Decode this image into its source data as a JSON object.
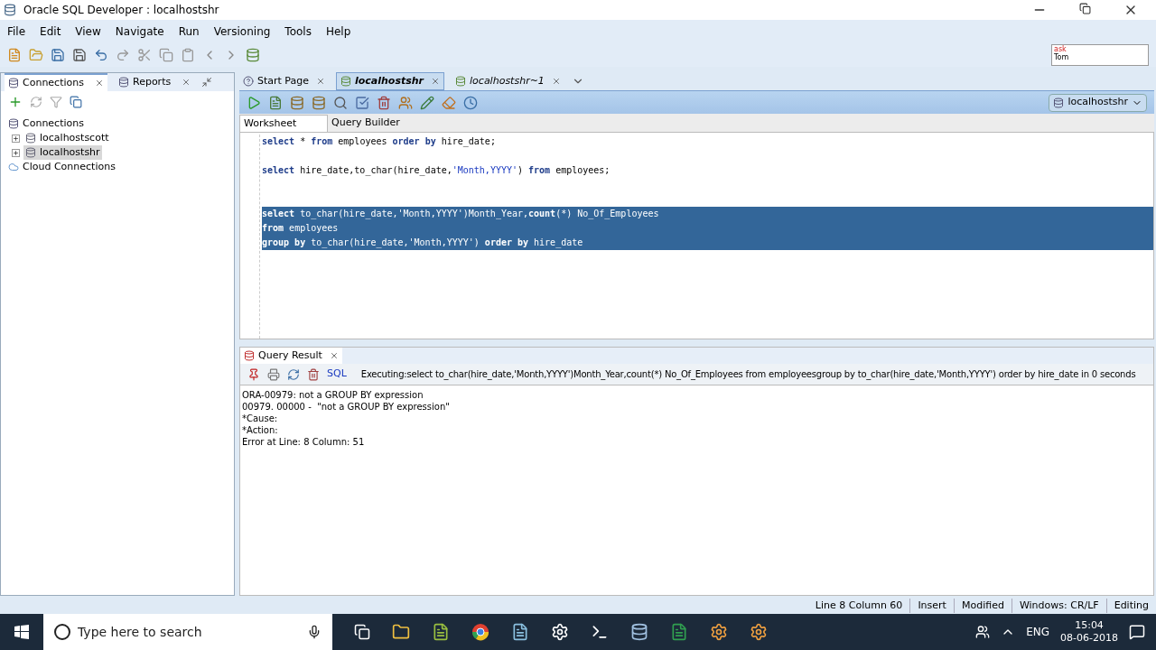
{
  "window": {
    "title": "Oracle SQL Developer : localhostshr"
  },
  "menu": [
    "File",
    "Edit",
    "View",
    "Navigate",
    "Run",
    "Versioning",
    "Tools",
    "Help"
  ],
  "asktom": {
    "line1": "ask",
    "line2": "Tom"
  },
  "left_tabs": [
    {
      "label": "Connections",
      "selected": true
    },
    {
      "label": "Reports",
      "selected": false
    }
  ],
  "tree": [
    {
      "label": "Connections",
      "kind": "root",
      "children": [
        {
          "label": "localhostscott",
          "kind": "db",
          "selected": false
        },
        {
          "label": "localhostshr",
          "kind": "db",
          "selected": true
        }
      ]
    },
    {
      "label": "Cloud Connections",
      "kind": "cloud"
    }
  ],
  "editor_tabs": [
    {
      "label": "Start Page",
      "selected": false,
      "italic": false
    },
    {
      "label": "localhostshr",
      "selected": true,
      "italic": true
    },
    {
      "label": "localhostshr~1",
      "selected": false,
      "italic": true
    }
  ],
  "connection_select": "localhostshr",
  "sub_tabs": [
    {
      "label": "Worksheet",
      "selected": true
    },
    {
      "label": "Query Builder",
      "selected": false
    }
  ],
  "code": [
    {
      "kind": "code",
      "selected": false,
      "tokens": [
        {
          "t": "select",
          "kind": "kw"
        },
        {
          "t": " * ",
          "kind": "plain"
        },
        {
          "t": "from",
          "kind": "kw"
        },
        {
          "t": " employees ",
          "kind": "plain"
        },
        {
          "t": "order by",
          "kind": "kw"
        },
        {
          "t": " hire_date;",
          "kind": "plain"
        }
      ]
    },
    {
      "kind": "blank",
      "selected": false
    },
    {
      "kind": "code",
      "selected": false,
      "tokens": [
        {
          "t": "select",
          "kind": "kw"
        },
        {
          "t": " hire_date,to_char(hire_date,",
          "kind": "plain"
        },
        {
          "t": "'Month,YYYY'",
          "kind": "str"
        },
        {
          "t": ") ",
          "kind": "plain"
        },
        {
          "t": "from",
          "kind": "kw"
        },
        {
          "t": " employees;",
          "kind": "plain"
        }
      ]
    },
    {
      "kind": "blank",
      "selected": false
    },
    {
      "kind": "blank",
      "selected": false
    },
    {
      "kind": "code",
      "selected": true,
      "tokens": [
        {
          "t": "select",
          "kind": "kw"
        },
        {
          "t": " to_char(hire_date,'Month,YYYY')Month_Year,",
          "kind": "plain"
        },
        {
          "t": "count",
          "kind": "kw"
        },
        {
          "t": "(*) No_Of_Employees",
          "kind": "plain"
        }
      ]
    },
    {
      "kind": "code",
      "selected": true,
      "tokens": [
        {
          "t": "from",
          "kind": "kw"
        },
        {
          "t": " employees",
          "kind": "plain"
        }
      ]
    },
    {
      "kind": "code",
      "selected": true,
      "tokens": [
        {
          "t": "group by",
          "kind": "kw"
        },
        {
          "t": " to_char(hire_date,'Month,YYYY') ",
          "kind": "plain"
        },
        {
          "t": "order by",
          "kind": "kw"
        },
        {
          "t": " hire_date",
          "kind": "plain"
        }
      ]
    }
  ],
  "result": {
    "tab": "Query Result",
    "sql_label": "SQL",
    "executing": "Executing:select to_char(hire_date,'Month,YYYY')Month_Year,count(*) No_Of_Employees from employeesgroup by to_char(hire_date,'Month,YYYY') order by hire_date in 0 seconds",
    "output": [
      "ORA-00979: not a GROUP BY expression",
      "00979. 00000 -  \"not a GROUP BY expression\"",
      "*Cause:",
      "*Action:",
      "Error at Line: 8 Column: 51"
    ]
  },
  "status_bar": [
    "Line 8 Column 60",
    "Insert",
    "Modified",
    "Windows: CR/LF",
    "Editing"
  ],
  "taskbar": {
    "search_placeholder": "Type here to search",
    "language": "ENG",
    "time": "15:04",
    "date": "08-06-2018"
  }
}
